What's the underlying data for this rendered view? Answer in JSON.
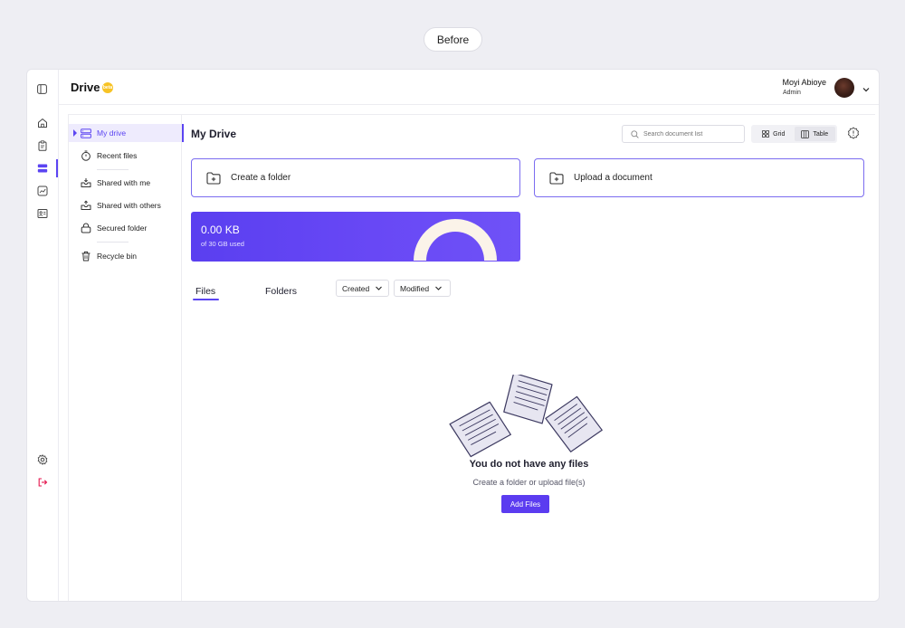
{
  "before_label": "Before",
  "app": {
    "title": "Drive",
    "beta_badge": "beta"
  },
  "user": {
    "name": "Moyi Abioye",
    "role": "Admin"
  },
  "rail": {
    "icons": [
      "sidebar-toggle-icon",
      "home-icon",
      "clipboard-icon",
      "drive-icon",
      "chart-icon",
      "contacts-icon",
      "settings-icon",
      "logout-icon"
    ],
    "active": "drive-icon"
  },
  "subnav": {
    "items": [
      {
        "label": "My drive",
        "icon": "drive-icon",
        "active": true
      },
      {
        "label": "Recent files",
        "icon": "timer-icon"
      },
      {
        "label": "Shared with me",
        "icon": "inbox-icon"
      },
      {
        "label": "Shared with others",
        "icon": "outbox-icon"
      },
      {
        "label": "Secured folder",
        "icon": "lock-icon"
      },
      {
        "label": "Recycle bin",
        "icon": "trash-icon"
      }
    ]
  },
  "main": {
    "title": "My Drive",
    "search_placeholder": "Search document list",
    "view": {
      "grid_label": "Grid",
      "table_label": "Table",
      "selected": "Table"
    },
    "actions": {
      "create_folder": "Create a folder",
      "upload_document": "Upload a document"
    },
    "storage": {
      "used": "0.00 KB",
      "subtitle": "of 30 GB used",
      "fraction_used": 0.0
    },
    "tabs": {
      "files": "Files",
      "folders": "Folders",
      "selected": "Files"
    },
    "sorts": {
      "created": "Created",
      "modified": "Modified"
    },
    "empty": {
      "title": "You do not have any files",
      "subtitle": "Create a folder or upload file(s)",
      "button": "Add Files"
    }
  },
  "colors": {
    "accent": "#5b44f2",
    "card_border": "#7b6cf0",
    "gauge": "#fbf3e9",
    "beta": "#f7c325",
    "logout": "#e5174f"
  }
}
